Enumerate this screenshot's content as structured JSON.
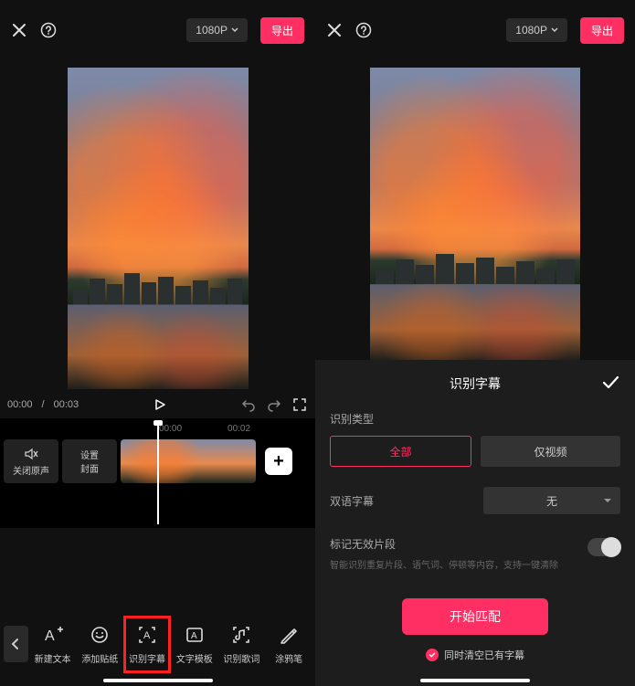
{
  "left": {
    "topbar": {
      "resolution": "1080P",
      "export": "导出"
    },
    "time": {
      "current": "00:00",
      "total": "00:03"
    },
    "timeline": {
      "marks": [
        "00:00",
        "00:02"
      ],
      "mute": "关闭原声",
      "cover": "设置\n封面"
    },
    "tools": {
      "back": "‹",
      "items": [
        {
          "key": "new-text",
          "label": "新建文本"
        },
        {
          "key": "sticker",
          "label": "添加贴纸"
        },
        {
          "key": "subtitle",
          "label": "识别字幕"
        },
        {
          "key": "template",
          "label": "文字模板"
        },
        {
          "key": "lyrics",
          "label": "识别歌词"
        },
        {
          "key": "doodle",
          "label": "涂鸦笔"
        }
      ]
    }
  },
  "right": {
    "topbar": {
      "resolution": "1080P",
      "export": "导出"
    },
    "panel": {
      "title": "识别字幕",
      "type_label": "识别类型",
      "type_options": {
        "all": "全部",
        "video_only": "仅视频"
      },
      "bilingual_label": "双语字幕",
      "bilingual_value": "无",
      "invalid_label": "标记无效片段",
      "invalid_hint": "智能识别重复片段、语气词、停顿等内容，支持一键清除",
      "start": "开始匹配",
      "clear_existing": "同时清空已有字幕"
    }
  }
}
